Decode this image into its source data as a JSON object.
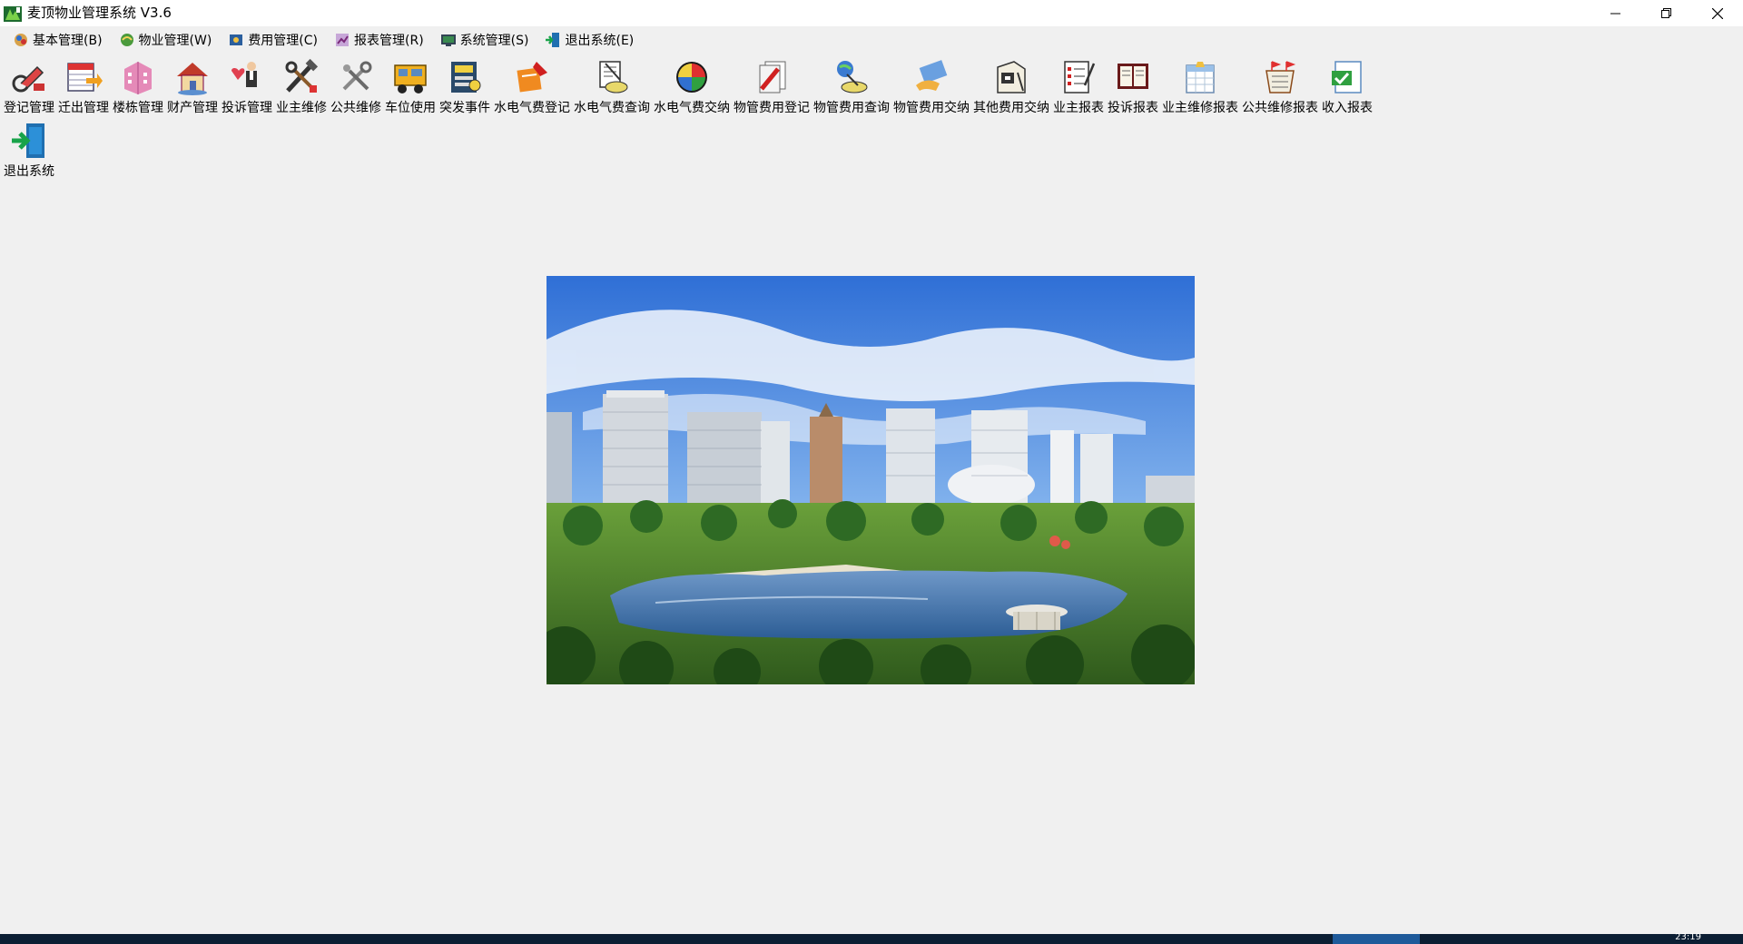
{
  "window": {
    "title": "麦顶物业管理系统 V3.6",
    "controls": [
      "minimize-icon",
      "restore-icon",
      "close-icon"
    ]
  },
  "menu": [
    {
      "label": "基本管理(B)",
      "icon": "basic-manage-icon"
    },
    {
      "label": "物业管理(W)",
      "icon": "property-manage-icon"
    },
    {
      "label": "费用管理(C)",
      "icon": "fee-manage-icon"
    },
    {
      "label": "报表管理(R)",
      "icon": "report-manage-icon"
    },
    {
      "label": "系统管理(S)",
      "icon": "system-manage-icon"
    },
    {
      "label": "退出系统(E)",
      "icon": "exit-system-icon"
    }
  ],
  "toolbar": [
    {
      "label": "登记管理",
      "icon": "register-icon"
    },
    {
      "label": "迁出管理",
      "icon": "move-out-icon"
    },
    {
      "label": "楼栋管理",
      "icon": "building-icon"
    },
    {
      "label": "财产管理",
      "icon": "property-house-icon"
    },
    {
      "label": "投诉管理",
      "icon": "complaint-icon"
    },
    {
      "label": "业主维修",
      "icon": "owner-repair-icon"
    },
    {
      "label": "公共维修",
      "icon": "public-repair-icon"
    },
    {
      "label": "车位使用",
      "icon": "parking-truck-icon"
    },
    {
      "label": "突发事件",
      "icon": "emergency-icon"
    },
    {
      "label": "水电气费登记",
      "icon": "utility-register-icon"
    },
    {
      "label": "水电气费查询",
      "icon": "utility-query-icon"
    },
    {
      "label": "水电气费交纳",
      "icon": "utility-pay-icon"
    },
    {
      "label": "物管费用登记",
      "icon": "mgmt-fee-register-icon"
    },
    {
      "label": "物管费用查询",
      "icon": "mgmt-fee-query-icon"
    },
    {
      "label": "物管费用交纳",
      "icon": "mgmt-fee-pay-icon"
    },
    {
      "label": "其他费用交纳",
      "icon": "other-fee-pay-icon"
    },
    {
      "label": "业主报表",
      "icon": "owner-report-icon"
    },
    {
      "label": "投诉报表",
      "icon": "complaint-report-icon"
    },
    {
      "label": "业主维修报表",
      "icon": "owner-repair-report-icon"
    },
    {
      "label": "公共维修报表",
      "icon": "public-repair-report-icon"
    },
    {
      "label": "收入报表",
      "icon": "income-report-icon"
    }
  ],
  "toolbar_row2": [
    {
      "label": "退出系统",
      "icon": "exit-icon"
    }
  ],
  "statusbar": {
    "time": "23:19",
    "colors": {
      "bar": "#0b1e33",
      "segment": "#1e5a9a"
    }
  },
  "colors": {
    "background": "#f0f0f0",
    "titlebar": "#ffffff"
  }
}
